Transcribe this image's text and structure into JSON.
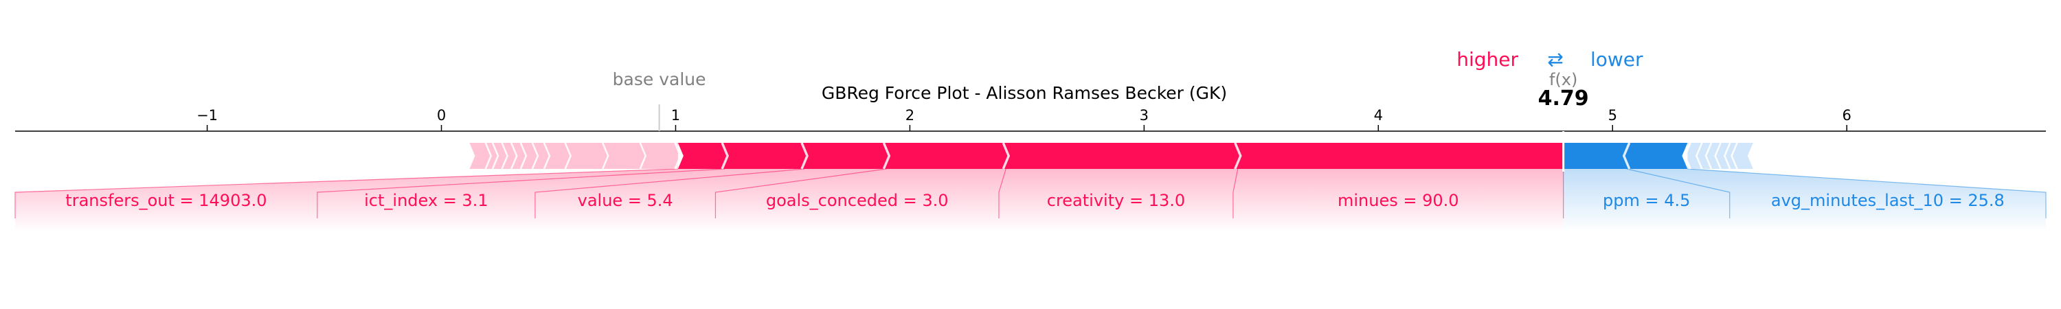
{
  "chart_data": {
    "type": "force",
    "title": "GBReg Force Plot - Alisson Ramses Becker (GK)",
    "base_value_label": "base value",
    "fx_label": "f(x)",
    "output_value_label": "4.79",
    "higher_label": "higher",
    "lower_label": "lower",
    "arrows_glyph": "⇄",
    "base_value": 0.93,
    "output_value": 4.79,
    "xlim": [
      -1.82,
      6.85
    ],
    "ticks": [
      {
        "value": -1,
        "label": "−1"
      },
      {
        "value": 0,
        "label": "0"
      },
      {
        "value": 1,
        "label": "1"
      },
      {
        "value": 2,
        "label": "2"
      },
      {
        "value": 3,
        "label": "3"
      },
      {
        "value": 4,
        "label": "4"
      },
      {
        "value": 5,
        "label": "5"
      },
      {
        "value": 6,
        "label": "6"
      }
    ],
    "positive_features": [
      {
        "label": "minues = 90.0",
        "from": 3.4,
        "to": 4.79
      },
      {
        "label": "creativity = 13.0",
        "from": 2.41,
        "to": 3.4
      },
      {
        "label": "goals_conceded = 3.0",
        "from": 1.9,
        "to": 2.41
      },
      {
        "label": "value = 5.4",
        "from": 1.55,
        "to": 1.9
      },
      {
        "label": "ict_index = 3.1",
        "from": 1.21,
        "to": 1.55
      },
      {
        "label": "transfers_out = 14903.0",
        "from": 1.01,
        "to": 1.21
      }
    ],
    "positive_minor_boundaries": [
      0.86,
      0.7,
      0.54,
      0.45,
      0.4,
      0.35,
      0.31,
      0.27,
      0.23,
      0.2
    ],
    "positive_tail_end": 0.12,
    "negative_features": [
      {
        "label": "ppm = 4.5",
        "from": 4.79,
        "to": 5.06
      },
      {
        "label": "avg_minutes_last_10 = 25.8",
        "from": 5.06,
        "to": 5.32
      }
    ],
    "negative_minor_boundaries": [
      5.37,
      5.41,
      5.45,
      5.49,
      5.52
    ],
    "negative_tail_end": 5.6,
    "label_region_edges_positive": [
      -1.82,
      -0.53,
      0.4,
      1.17,
      2.38,
      3.38,
      4.79
    ],
    "label_region_edges_negative": [
      4.79,
      5.5,
      6.85
    ],
    "colors": {
      "positive": "#ff0d57",
      "negative": "#1e88e5",
      "positive_light": "#ffc3d5",
      "negative_light": "#d1e6fa",
      "axis": "#000000",
      "muted": "#808080"
    }
  }
}
